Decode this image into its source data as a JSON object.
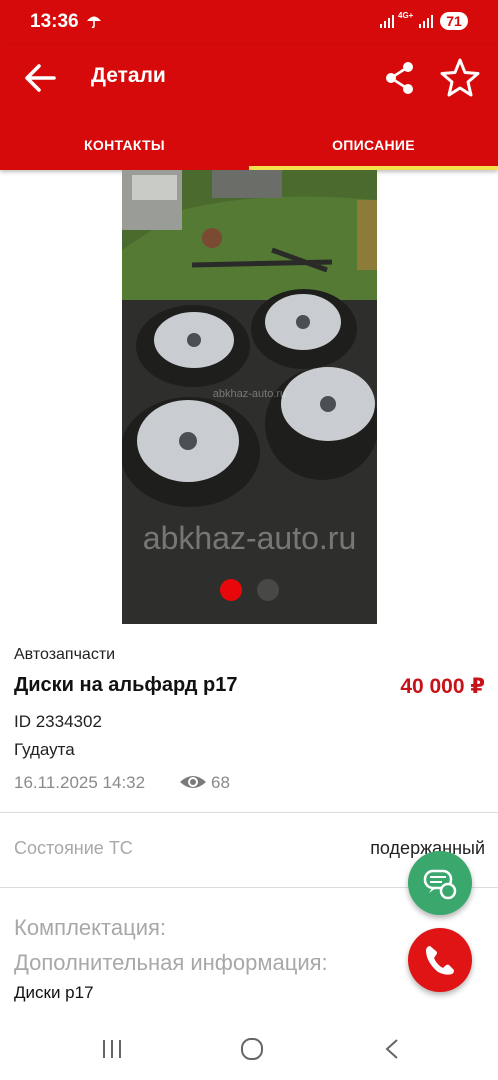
{
  "status_bar": {
    "time": "13:36",
    "network": "4G+",
    "battery": "71",
    "icons": [
      "umbrella-icon",
      "signal-icon",
      "battery-icon"
    ]
  },
  "app_bar": {
    "title": "Детали",
    "icons": [
      "back-arrow-icon",
      "share-icon",
      "star-icon"
    ],
    "tabs": [
      {
        "label": "КОНТАКТЫ",
        "active": false
      },
      {
        "label": "ОПИСАНИЕ",
        "active": true
      }
    ]
  },
  "gallery": {
    "watermark": "abkhaz-auto.ru",
    "current_index": 1,
    "total": 2
  },
  "ad": {
    "category": "Автозапчасти",
    "title": "Диски на альфард р17",
    "price": "40 000 ₽",
    "id": "ID 2334302",
    "city": "Гудаута",
    "date": "16.11.2025 14:32",
    "views": "68"
  },
  "details": {
    "condition_label": "Состояние ТС",
    "condition_value": "подержанный",
    "equipment_label": "Комплектация:",
    "extra_label": "Дополнительная информация:",
    "description": "Диски р17"
  },
  "colors": {
    "brand": "#d60a0a",
    "tab_indicator": "#f4e04d",
    "price": "#c8121a",
    "chat_fab": "#3aa76d",
    "call_fab": "#e01414"
  }
}
